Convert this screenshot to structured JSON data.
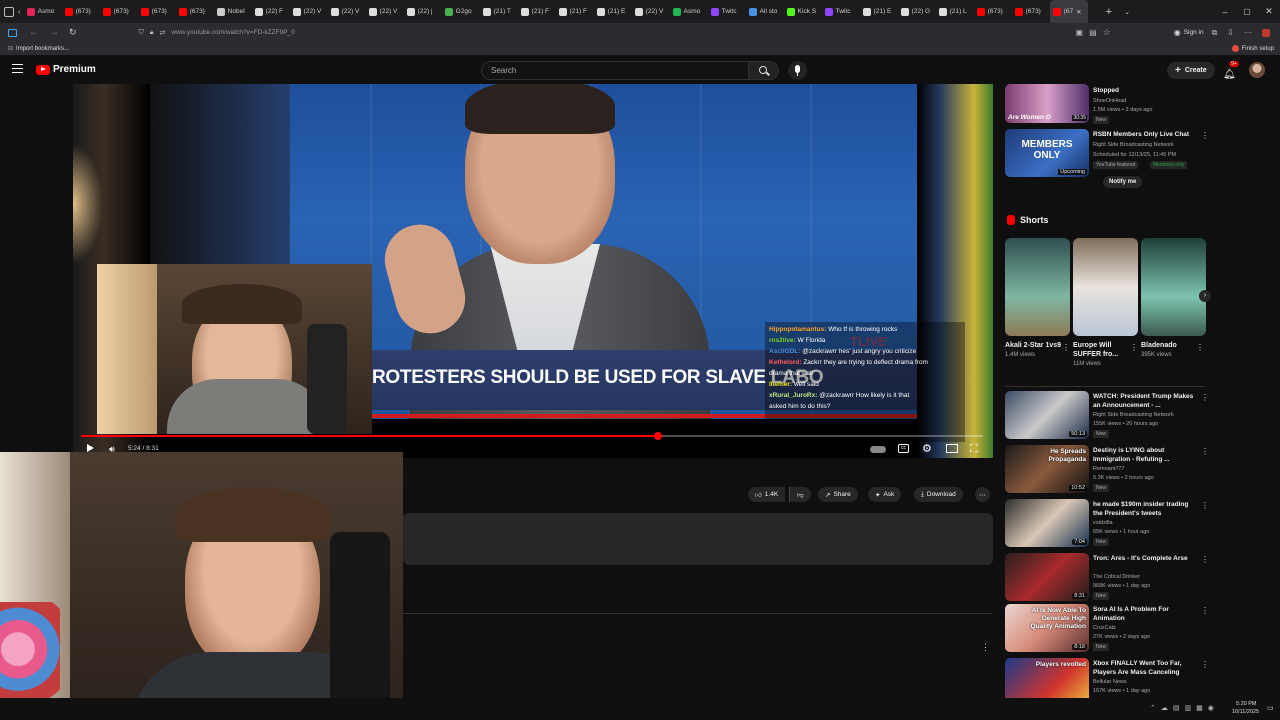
{
  "browser": {
    "tabs": [
      {
        "label": "Asmo",
        "color": "#e0245e"
      },
      {
        "label": "(673)",
        "color": "#ff0000"
      },
      {
        "label": "(673)",
        "color": "#ff0000"
      },
      {
        "label": "(673)",
        "color": "#ff0000"
      },
      {
        "label": "(673)",
        "color": "#ff0000"
      },
      {
        "label": "Nobel",
        "color": "#cccccc"
      },
      {
        "label": "(22) F",
        "color": "#dddddd"
      },
      {
        "label": "(22) V",
        "color": "#dddddd"
      },
      {
        "label": "(22) V",
        "color": "#dddddd"
      },
      {
        "label": "(22) V",
        "color": "#dddddd"
      },
      {
        "label": "(22) j",
        "color": "#dddddd"
      },
      {
        "label": "G2go",
        "color": "#4caf50"
      },
      {
        "label": "(21) T",
        "color": "#dddddd"
      },
      {
        "label": "(21) F",
        "color": "#dddddd"
      },
      {
        "label": "(21) F",
        "color": "#dddddd"
      },
      {
        "label": "(21) E",
        "color": "#dddddd"
      },
      {
        "label": "(22) V",
        "color": "#dddddd"
      },
      {
        "label": "Asmo",
        "color": "#1db954"
      },
      {
        "label": "Twitc",
        "color": "#9146ff"
      },
      {
        "label": "All sto",
        "color": "#4a90e2"
      },
      {
        "label": "Kick S",
        "color": "#53fc18"
      },
      {
        "label": "Twitc",
        "color": "#9146ff"
      },
      {
        "label": "(21) E",
        "color": "#dddddd"
      },
      {
        "label": "(22) G",
        "color": "#dddddd"
      },
      {
        "label": "(21) L",
        "color": "#dddddd"
      },
      {
        "label": "(673)",
        "color": "#ff0000"
      },
      {
        "label": "(673)",
        "color": "#ff0000"
      },
      {
        "label": "(67",
        "color": "#ff0000",
        "active": true
      }
    ],
    "url": "www.youtube.com/watch?v=FD-kZZF9P_0",
    "sign_in": "Sign in",
    "finish_setup": "Finish setup",
    "import_bookmarks": "Import bookmarks..."
  },
  "youtube": {
    "logo_text": "Premium",
    "search_placeholder": "Search",
    "create_label": "Create",
    "notif_count": "9+"
  },
  "video": {
    "chyron": "ROTESTERS SHOULD BE USED FOR SLAVE LABO",
    "live_tag": "TLIVE",
    "time": "5:24 / 8:31",
    "progress": 0.64,
    "chat": [
      {
        "user": "Hippopotamantus:",
        "msg": "Who tf is throwing rocks",
        "color": "#f5a623"
      },
      {
        "user": "rns2live:",
        "msg": "W Florida",
        "color": "#7ed321"
      },
      {
        "user": "AsciiGDL:",
        "msg": "@zackrawrr hes' just angry you criticize",
        "color": "#4a90e2"
      },
      {
        "user": "Kethelord:",
        "msg": "Zackrr they are trying to deflect drama from",
        "color": "#ff5a5a"
      },
      {
        "user": "",
        "msg": "drama that's all",
        "color": "#ffffff"
      },
      {
        "user": "lliemer:",
        "msg": "well said",
        "color": "#f8e71c"
      },
      {
        "user": "xRural_JuroRx:",
        "msg": "@zackrawrr How likely is it that",
        "color": "#b8e986"
      },
      {
        "user": "",
        "msg": "asked him to do this?",
        "color": "#ffffff"
      }
    ]
  },
  "actions": {
    "likes": "1.4K",
    "share": "Share",
    "ask": "Ask",
    "download": "Download"
  },
  "sidebar": {
    "top_partial": {
      "title": "Stopped",
      "channel": "ShoeOnHead",
      "meta": "1.5M views • 3 days ago",
      "badge": "New",
      "duration": "30:35",
      "thumb_text": "Are Women O"
    },
    "members": {
      "title": "RSBN Members Only Live Chat",
      "channel": "Right Side Broadcasting Network",
      "meta": "Scheduled for 12/13/25, 11:45 PM",
      "badge1": "YouTube featured",
      "badge2": "Members only",
      "notify": "Notify me",
      "thumb_text": "MEMBERS ONLY",
      "upcoming": "Upcoming"
    },
    "shorts_label": "Shorts",
    "shorts": [
      {
        "title": "Akali 2-Star 1vs9",
        "views": "1.4M views"
      },
      {
        "title": "Europe Will SUFFER fro...",
        "views": "11M views"
      },
      {
        "title": "Bladenado",
        "views": "395K views"
      }
    ],
    "recs": [
      {
        "title": "WATCH: President Trump Makes an Announcement - ...",
        "channel": "Right Side Broadcasting Network",
        "meta": "155K views • 20 hours ago",
        "badge": "New",
        "duration": "50:13"
      },
      {
        "title": "Destiny is LYING about Immigration - Refuting ...",
        "channel": "Remnant777",
        "meta": "5.3K views • 2 hours ago",
        "badge": "New",
        "duration": "10:52",
        "thumb_text": "He Spreads Propaganda"
      },
      {
        "title": "he made $190m insider trading the President's tweets",
        "channel": "voidzilla",
        "meta": "65K views • 1 hour ago",
        "badge": "New",
        "duration": "7:04"
      },
      {
        "title": "Tron: Ares - It's Complete Arse",
        "channel": "The Critical Drinker",
        "meta": "968K views • 1 day ago",
        "badge": "New",
        "duration": "8:31"
      },
      {
        "title": "Sora AI Is A Problem For Animation",
        "channel": "CruzCatz",
        "meta": "27K views • 2 days ago",
        "badge": "New",
        "duration": "8:18",
        "thumb_text": "AI Is Now Able To Generate High Quality Animation"
      },
      {
        "title": "Xbox FINALLY Went Too Far, Players Are Mass Canceling",
        "channel": "Bellular News",
        "meta": "167K views • 1 day ago",
        "badge": "",
        "duration": "",
        "thumb_text": "Players revolted"
      }
    ]
  },
  "taskbar": {
    "time": "5:20 PM",
    "date": "10/11/2025"
  },
  "colors": {
    "accent": "#ff0000",
    "bg": "#0f0f0f"
  }
}
